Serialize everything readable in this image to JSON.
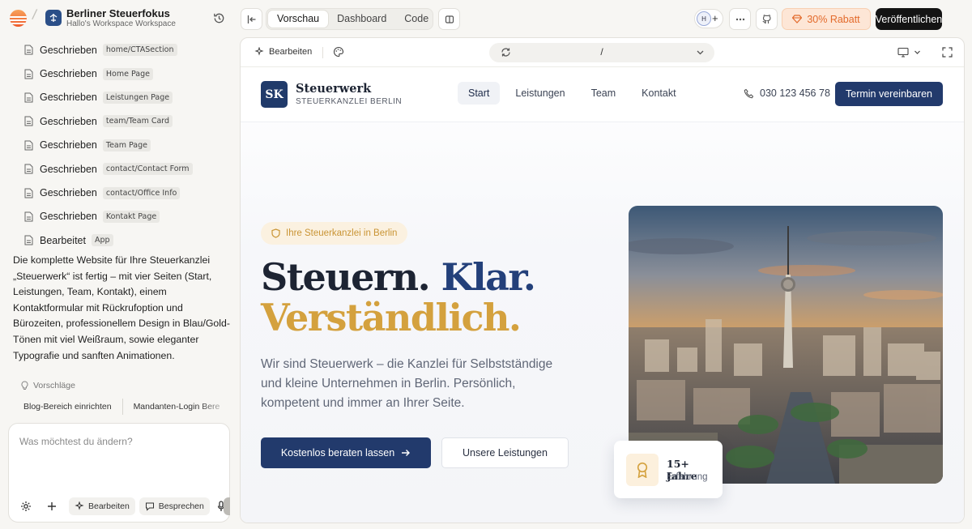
{
  "project": {
    "name": "Berliner Steuerfokus",
    "workspace": "Hallo's Workspace Workspace"
  },
  "files": [
    {
      "action": "Geschrieben",
      "path": "home/CTASection"
    },
    {
      "action": "Geschrieben",
      "path": "Home Page"
    },
    {
      "action": "Geschrieben",
      "path": "Leistungen Page"
    },
    {
      "action": "Geschrieben",
      "path": "team/Team Card"
    },
    {
      "action": "Geschrieben",
      "path": "Team Page"
    },
    {
      "action": "Geschrieben",
      "path": "contact/Contact Form"
    },
    {
      "action": "Geschrieben",
      "path": "contact/Office Info"
    },
    {
      "action": "Geschrieben",
      "path": "Kontakt Page"
    },
    {
      "action": "Bearbeitet",
      "path": "App"
    }
  ],
  "summary": "Die komplette Website für Ihre Steuerkanzlei „Steuerwerk“ ist fertig – mit vier Seiten (Start, Leistungen, Team, Kontakt), einem Kontaktformular mit Rückrufoption und Bürozeiten, professionellem Design in Blau/Gold-Tönen mit viel Weißraum, sowie eleganter Typografie und sanften Animationen.",
  "suggestions": {
    "title": "Vorschläge",
    "items": [
      "Blog-Bereich einrichten",
      "Mandanten-Login Bere"
    ]
  },
  "composer": {
    "placeholder": "Was möchtest du ändern?",
    "edit_label": "Bearbeiten",
    "discuss_label": "Besprechen"
  },
  "topbar": {
    "tabs": [
      {
        "label": "Vorschau",
        "active": true
      },
      {
        "label": "Dashboard",
        "active": false
      },
      {
        "label": "Code",
        "active": false
      }
    ],
    "avatar_initial": "H",
    "avatar_plus": "+",
    "promo_label": "30% Rabatt",
    "publish_label": "Veröffentlichen"
  },
  "preview_toolbar": {
    "edit_label": "Bearbeiten",
    "url_path": "/"
  },
  "site": {
    "logo_initials": "SK",
    "brand_name": "Steuerwerk",
    "brand_sub": "STEUERKANZLEI BERLIN",
    "nav": [
      {
        "label": "Start",
        "active": true
      },
      {
        "label": "Leistungen",
        "active": false
      },
      {
        "label": "Team",
        "active": false
      },
      {
        "label": "Kontakt",
        "active": false
      }
    ],
    "phone": "030 123 456 78",
    "cta_top": "Termin vereinbaren",
    "badge": "Ihre Steuerkanzlei in Berlin",
    "headline_part1": "Steuern.",
    "headline_part2": "Klar.",
    "headline_line2": "Verständlich.",
    "lead": "Wir sind Steuerwerk – die Kanzlei für Selbstständige und kleine Unternehmen in Berlin. Persönlich, kompetent und immer an Ihrer Seite.",
    "btn_primary": "Kostenlos beraten lassen",
    "btn_secondary": "Unsere Leistungen",
    "exp_title": "15+ Jahre",
    "exp_sub": "Erfahrung"
  },
  "colors": {
    "brand_navy": "#223a6c",
    "brand_gold": "#d4a13e",
    "promo_orange": "#e36a2b"
  }
}
